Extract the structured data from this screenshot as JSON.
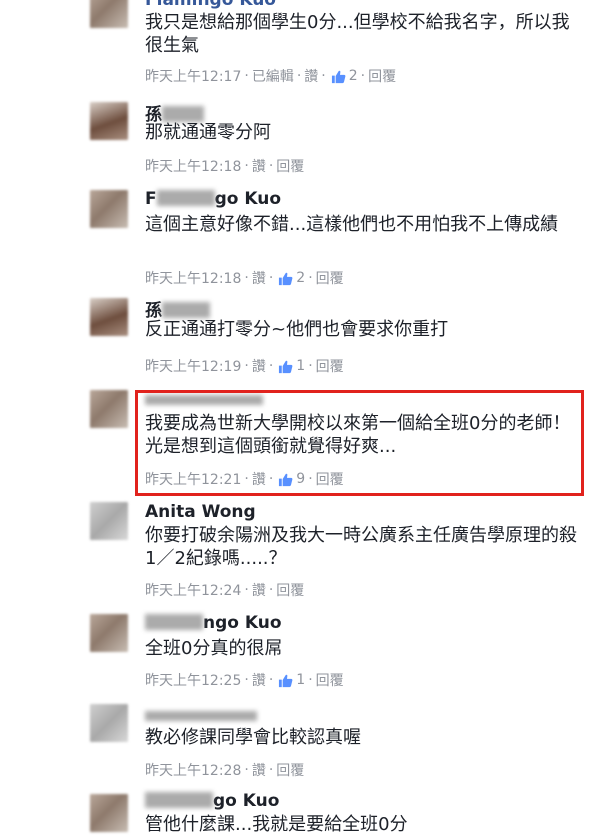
{
  "comments": [
    {
      "name": "Flamingo Kuo",
      "text": "我只是想給那個學生0分...但學校不給我名字，所以我很生氣",
      "time": "昨天上午12:17",
      "edited": "已編輯",
      "like": "讚",
      "like_count": "2",
      "reply": "回覆"
    },
    {
      "name": "孫",
      "text": "那就通通零分阿",
      "time": "昨天上午12:18",
      "like": "讚",
      "reply": "回覆"
    },
    {
      "name": "go Kuo",
      "name_prefix": "F",
      "text": "這個主意好像不錯...這樣他們也不用怕我不上傳成績",
      "time": "昨天上午12:18",
      "like": "讚",
      "like_count": "2",
      "reply": "回覆"
    },
    {
      "name": "孫",
      "text": "反正通通打零分~他們也會要求你重打",
      "time": "昨天上午12:19",
      "like": "讚",
      "like_count": "1",
      "reply": "回覆"
    },
    {
      "text": "我要成為世新大學開校以來第一個給全班0分的老師！光是想到這個頭銜就覺得好爽...",
      "time": "昨天上午12:21",
      "like": "讚",
      "like_count": "9",
      "reply": "回覆"
    },
    {
      "name": "Anita Wong",
      "text": "你要打破余陽洲及我大一時公廣系主任廣告學原理的殺1／2紀錄嗎.....？",
      "time": "昨天上午12:24",
      "like": "讚",
      "reply": "回覆"
    },
    {
      "name": "ngo Kuo",
      "text": "全班0分真的很屌",
      "time": "昨天上午12:25",
      "like": "讚",
      "like_count": "1",
      "reply": "回覆"
    },
    {
      "text": "教必修課同學會比較認真喔",
      "time": "昨天上午12:28",
      "like": "讚",
      "reply": "回覆"
    },
    {
      "name": "go Kuo",
      "text": "管他什麼課...我就是要給全班0分",
      "time": "",
      "like": "",
      "reply": ""
    }
  ],
  "colors": {
    "name": "#365899",
    "meta": "#90949c",
    "highlight": "#e1221d",
    "like_icon": "#5890ff"
  }
}
